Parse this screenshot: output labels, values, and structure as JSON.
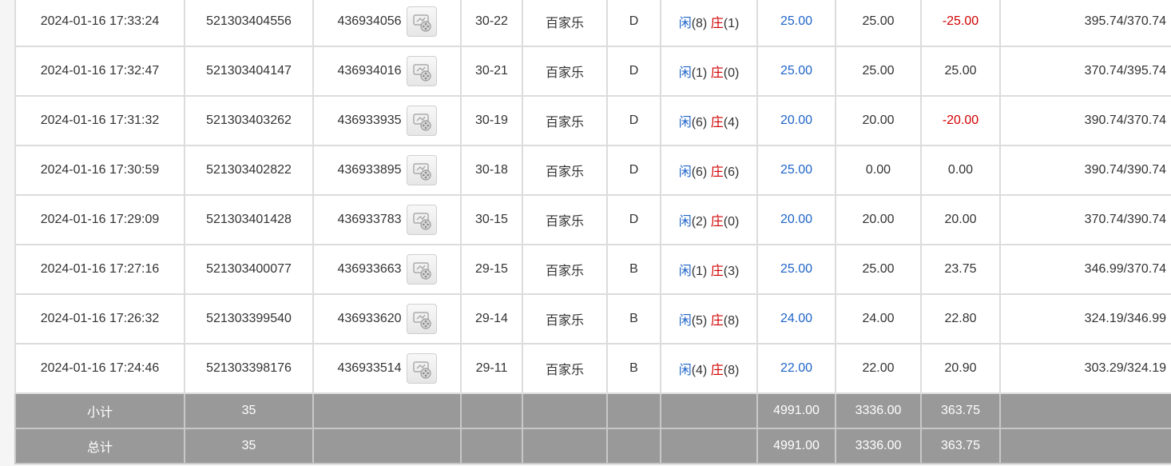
{
  "rows": [
    {
      "time": "2024-01-16 17:33:24",
      "order": "521303404556",
      "round": "436934056",
      "shoe": "30-22",
      "game": "百家乐",
      "bet": "D",
      "p_label": "闲",
      "p_val": "(8)",
      "b_label": "庄",
      "b_val": "(1)",
      "bet_amount": "25.00",
      "valid": "25.00",
      "winloss": "-25.00",
      "winloss_color": "red",
      "balance": "395.74/370.74"
    },
    {
      "time": "2024-01-16 17:32:47",
      "order": "521303404147",
      "round": "436934016",
      "shoe": "30-21",
      "game": "百家乐",
      "bet": "D",
      "p_label": "闲",
      "p_val": "(1)",
      "b_label": "庄",
      "b_val": "(0)",
      "bet_amount": "25.00",
      "valid": "25.00",
      "winloss": "25.00",
      "winloss_color": "normal",
      "balance": "370.74/395.74"
    },
    {
      "time": "2024-01-16 17:31:32",
      "order": "521303403262",
      "round": "436933935",
      "shoe": "30-19",
      "game": "百家乐",
      "bet": "D",
      "p_label": "闲",
      "p_val": "(6)",
      "b_label": "庄",
      "b_val": "(4)",
      "bet_amount": "20.00",
      "valid": "20.00",
      "winloss": "-20.00",
      "winloss_color": "red",
      "balance": "390.74/370.74"
    },
    {
      "time": "2024-01-16 17:30:59",
      "order": "521303402822",
      "round": "436933895",
      "shoe": "30-18",
      "game": "百家乐",
      "bet": "D",
      "p_label": "闲",
      "p_val": "(6)",
      "b_label": "庄",
      "b_val": "(6)",
      "bet_amount": "25.00",
      "valid": "0.00",
      "winloss": "0.00",
      "winloss_color": "normal",
      "balance": "390.74/390.74"
    },
    {
      "time": "2024-01-16 17:29:09",
      "order": "521303401428",
      "round": "436933783",
      "shoe": "30-15",
      "game": "百家乐",
      "bet": "D",
      "p_label": "闲",
      "p_val": "(2)",
      "b_label": "庄",
      "b_val": "(0)",
      "bet_amount": "20.00",
      "valid": "20.00",
      "winloss": "20.00",
      "winloss_color": "normal",
      "balance": "370.74/390.74"
    },
    {
      "time": "2024-01-16 17:27:16",
      "order": "521303400077",
      "round": "436933663",
      "shoe": "29-15",
      "game": "百家乐",
      "bet": "B",
      "p_label": "闲",
      "p_val": "(1)",
      "b_label": "庄",
      "b_val": "(3)",
      "bet_amount": "25.00",
      "valid": "25.00",
      "winloss": "23.75",
      "winloss_color": "normal",
      "balance": "346.99/370.74"
    },
    {
      "time": "2024-01-16 17:26:32",
      "order": "521303399540",
      "round": "436933620",
      "shoe": "29-14",
      "game": "百家乐",
      "bet": "B",
      "p_label": "闲",
      "p_val": "(5)",
      "b_label": "庄",
      "b_val": "(8)",
      "bet_amount": "24.00",
      "valid": "24.00",
      "winloss": "22.80",
      "winloss_color": "normal",
      "balance": "324.19/346.99"
    },
    {
      "time": "2024-01-16 17:24:46",
      "order": "521303398176",
      "round": "436933514",
      "shoe": "29-11",
      "game": "百家乐",
      "bet": "B",
      "p_label": "闲",
      "p_val": "(4)",
      "b_label": "庄",
      "b_val": "(8)",
      "bet_amount": "22.00",
      "valid": "22.00",
      "winloss": "20.90",
      "winloss_color": "normal",
      "balance": "303.29/324.19"
    }
  ],
  "subtotal": {
    "label": "小计",
    "count": "35",
    "bet_amount": "4991.00",
    "valid": "3336.00",
    "winloss": "363.75"
  },
  "total": {
    "label": "总计",
    "count": "35",
    "bet_amount": "4991.00",
    "valid": "3336.00",
    "winloss": "363.75"
  },
  "colors": {
    "blue": "#1f64c8",
    "red": "#d00000",
    "summary_bg": "#999999"
  },
  "icons": {
    "video": "video-replay-icon"
  }
}
